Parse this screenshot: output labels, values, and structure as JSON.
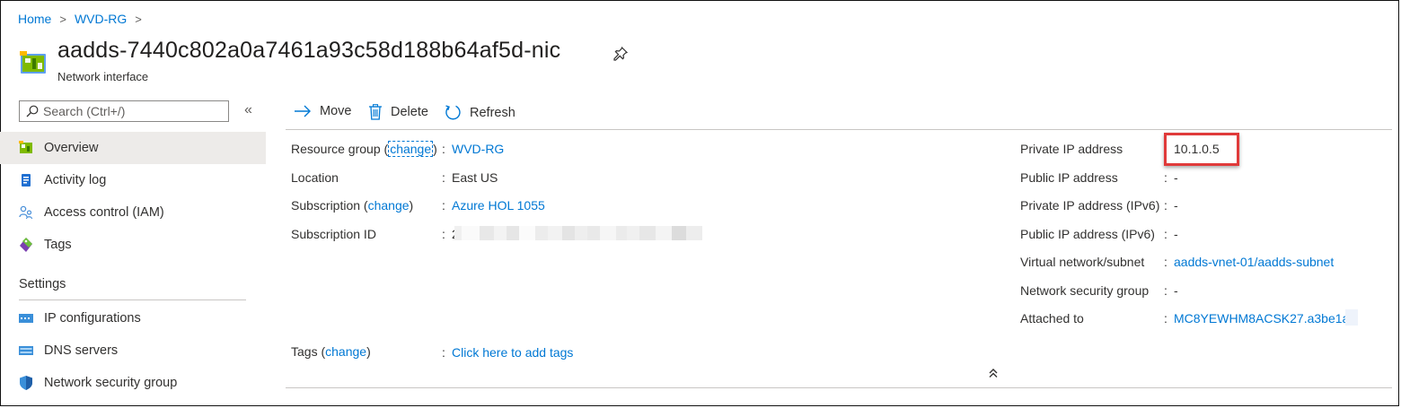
{
  "breadcrumb": {
    "items": [
      "Home",
      "WVD-RG"
    ],
    "separator": ">"
  },
  "resource": {
    "title": "aadds-7440c802a0a7461a93c58d188b64af5d-nic",
    "type": "Network interface",
    "icon": "network-interface-icon"
  },
  "sidebar": {
    "search_placeholder": "Search (Ctrl+/)",
    "collapse_glyph": "«",
    "items": [
      {
        "label": "Overview",
        "icon": "overview-icon",
        "active": true
      },
      {
        "label": "Activity log",
        "icon": "activity-log-icon"
      },
      {
        "label": "Access control (IAM)",
        "icon": "iam-icon"
      },
      {
        "label": "Tags",
        "icon": "tag-icon"
      }
    ],
    "section_title": "Settings",
    "settings_items": [
      {
        "label": "IP configurations",
        "icon": "ip-config-icon"
      },
      {
        "label": "DNS servers",
        "icon": "dns-icon"
      },
      {
        "label": "Network security group",
        "icon": "shield-icon"
      }
    ]
  },
  "toolbar": {
    "move": "Move",
    "delete": "Delete",
    "refresh": "Refresh"
  },
  "essentials": {
    "colon": ":",
    "resource_group": {
      "label": "Resource group",
      "change": "change",
      "value": "WVD-RG"
    },
    "location": {
      "label": "Location",
      "value": "East US"
    },
    "subscription": {
      "label": "Subscription",
      "change": "change",
      "value": "Azure HOL 1055"
    },
    "subscription_id": {
      "label": "Subscription ID",
      "value": "2"
    },
    "private_ip": {
      "label": "Private IP address",
      "value": "10.1.0.5"
    },
    "public_ip": {
      "label": "Public IP address",
      "value": "-"
    },
    "private_ipv6": {
      "label": "Private IP address (IPv6)",
      "value": "-"
    },
    "public_ipv6": {
      "label": "Public IP address (IPv6)",
      "value": "-"
    },
    "vnet_subnet": {
      "label": "Virtual network/subnet",
      "value": "aadds-vnet-01/aadds-subnet"
    },
    "nsg": {
      "label": "Network security group",
      "value": "-"
    },
    "attached_to": {
      "label": "Attached to",
      "value": "MC8YEWHM8ACSK27.a3be1a"
    },
    "tags": {
      "label": "Tags",
      "change": "change",
      "value": "Click here to add tags"
    }
  },
  "colors": {
    "link": "#0078d4",
    "highlight_border": "#e03a3a",
    "active_nav": "#edebe9"
  }
}
